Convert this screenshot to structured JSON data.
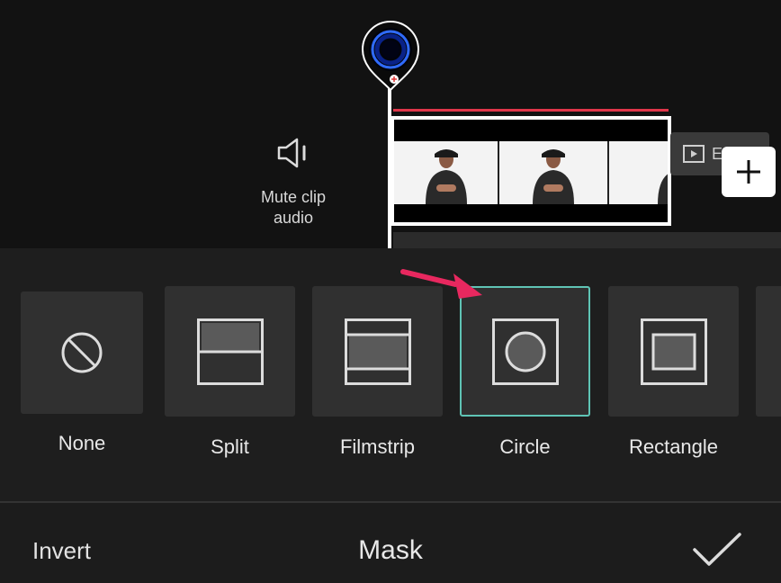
{
  "timeline": {
    "mute_label": "Mute clip\naudio",
    "end_label": "En",
    "add_icon": "plus-icon",
    "playhead_icon": "playhead-thumbnail",
    "speaker_icon": "speaker-muted-icon"
  },
  "mask_options": [
    {
      "label": "None",
      "icon": "none-circle-slash-icon",
      "selected": false
    },
    {
      "label": "Split",
      "icon": "split-mask-icon",
      "selected": false
    },
    {
      "label": "Filmstrip",
      "icon": "filmstrip-mask-icon",
      "selected": false
    },
    {
      "label": "Circle",
      "icon": "circle-mask-icon",
      "selected": true
    },
    {
      "label": "Rectangle",
      "icon": "rectangle-mask-icon",
      "selected": false
    }
  ],
  "bottom_bar": {
    "invert_label": "Invert",
    "title": "Mask",
    "confirm_icon": "checkmark-icon"
  },
  "colors": {
    "selection": "#5fc4b5",
    "arrow": "#e8285f",
    "track_marker": "#e0364a",
    "background": "#1c1c1c"
  }
}
